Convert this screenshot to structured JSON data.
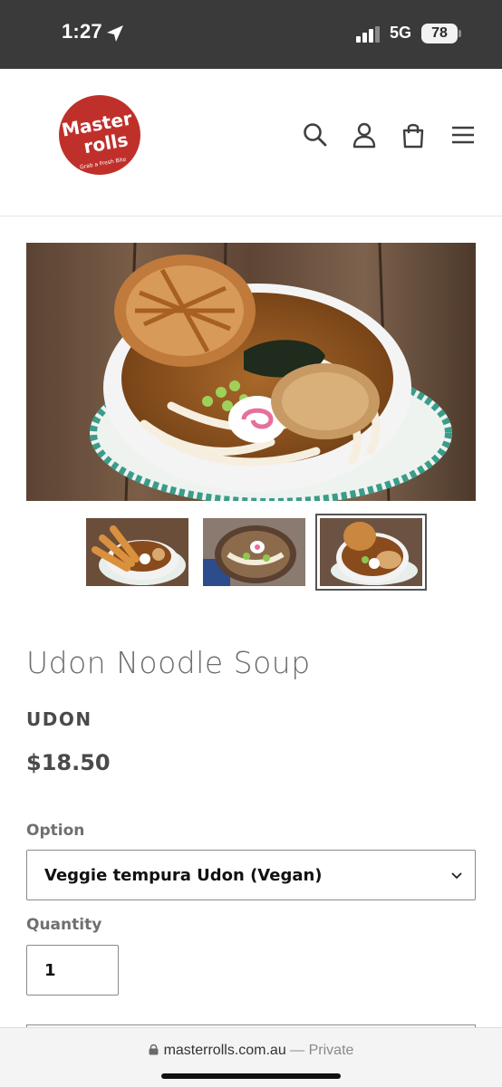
{
  "status_bar": {
    "time": "1:27",
    "network": "5G",
    "battery": "78"
  },
  "header": {
    "logo_text_line1": "Master",
    "logo_text_line2": "rolls",
    "logo_tagline": "Grab a Fresh Bite",
    "brand_color": "#c0302b",
    "icons": [
      "search-icon",
      "account-icon",
      "cart-icon",
      "menu-icon"
    ]
  },
  "gallery": {
    "thumbnails": [
      "thumb-tempura-udon",
      "thumb-udon-blue",
      "thumb-veggie-tempura-udon"
    ],
    "active_index": 2
  },
  "product": {
    "title": "Udon Noodle Soup",
    "vendor": "UDON",
    "price": "$18.50"
  },
  "option": {
    "label": "Option",
    "selected": "Veggie tempura Udon (Vegan)"
  },
  "quantity": {
    "label": "Quantity",
    "value": "1"
  },
  "browser": {
    "url": "masterrolls.com.au",
    "separator": " — ",
    "privacy": "Private"
  }
}
